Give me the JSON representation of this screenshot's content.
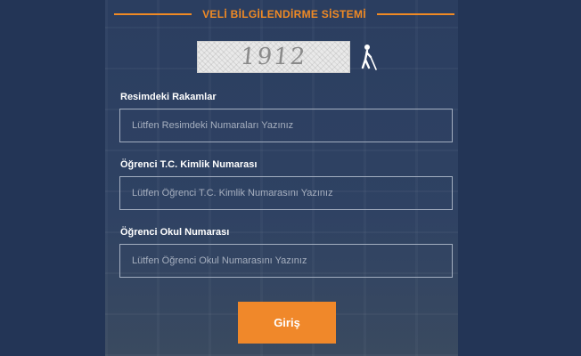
{
  "header": {
    "title": "VELİ BİLGİLENDİRME SİSTEMİ"
  },
  "captcha": {
    "text": "1912",
    "audio_icon": "wheelchair-accessibility-icon"
  },
  "form": {
    "captcha_label": "Resimdeki Rakamlar",
    "captcha_placeholder": "Lütfen Resimdeki Numaraları Yazınız",
    "tc_label": "Öğrenci T.C. Kimlik Numarası",
    "tc_placeholder": "Lütfen Öğrenci T.C. Kimlik Numarasını Yazınız",
    "school_label": "Öğrenci Okul Numarası",
    "school_placeholder": "Lütfen Öğrenci Okul Numarasını Yazınız",
    "submit_label": "Giriş"
  },
  "colors": {
    "accent": "#f08a24",
    "background": "#233556"
  }
}
